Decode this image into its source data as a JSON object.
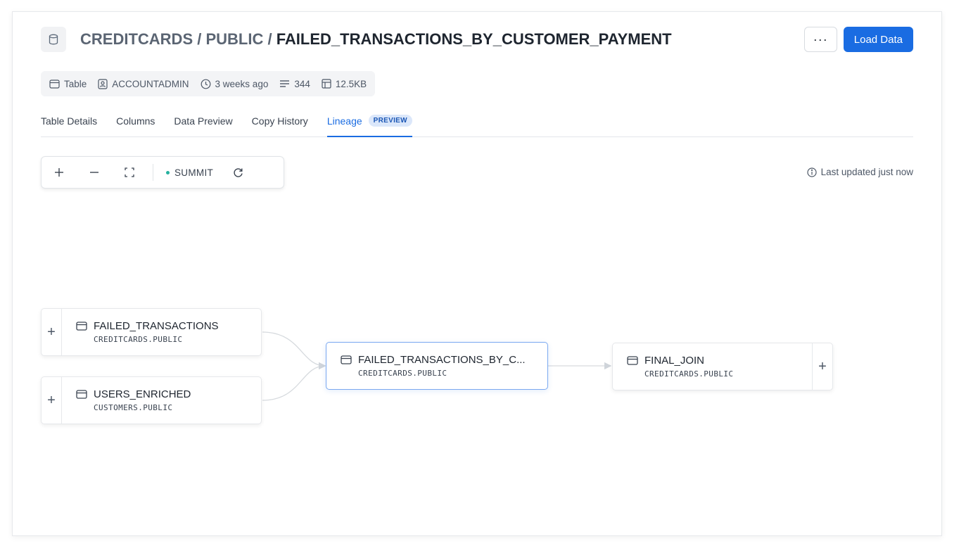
{
  "header": {
    "title_prefix": "CREDITCARDS / PUBLIC / ",
    "title_strong": "FAILED_TRANSACTIONS_BY_CUSTOMER_PAYMENT",
    "more_label": "···",
    "load_data_label": "Load Data"
  },
  "meta": {
    "type": "Table",
    "owner": "ACCOUNTADMIN",
    "updated": "3 weeks ago",
    "rows": "344",
    "size": "12.5KB"
  },
  "tabs": [
    {
      "label": "Table Details"
    },
    {
      "label": "Columns"
    },
    {
      "label": "Data Preview"
    },
    {
      "label": "Copy History"
    },
    {
      "label": "Lineage",
      "badge": "PREVIEW"
    }
  ],
  "toolbar": {
    "summit_label": "SUMMIT"
  },
  "last_updated": "Last updated just now",
  "nodes": {
    "failed_transactions": {
      "name": "FAILED_TRANSACTIONS",
      "schema": "CREDITCARDS.PUBLIC"
    },
    "users_enriched": {
      "name": "USERS_ENRICHED",
      "schema": "CUSTOMERS.PUBLIC"
    },
    "current": {
      "name": "FAILED_TRANSACTIONS_BY_C...",
      "schema": "CREDITCARDS.PUBLIC"
    },
    "final_join": {
      "name": "FINAL_JOIN",
      "schema": "CREDITCARDS.PUBLIC"
    }
  },
  "colors": {
    "accent": "#1a6ce2",
    "status_dot": "#25b19f"
  },
  "icons": {
    "database": "database-icon",
    "table": "table-icon",
    "user": "user-badge-icon",
    "clock": "clock-icon",
    "rows": "rows-icon",
    "size": "storage-icon",
    "plus": "plus-icon",
    "minus": "minus-icon",
    "fit": "fit-screen-icon",
    "refresh": "refresh-icon",
    "info": "info-icon"
  }
}
